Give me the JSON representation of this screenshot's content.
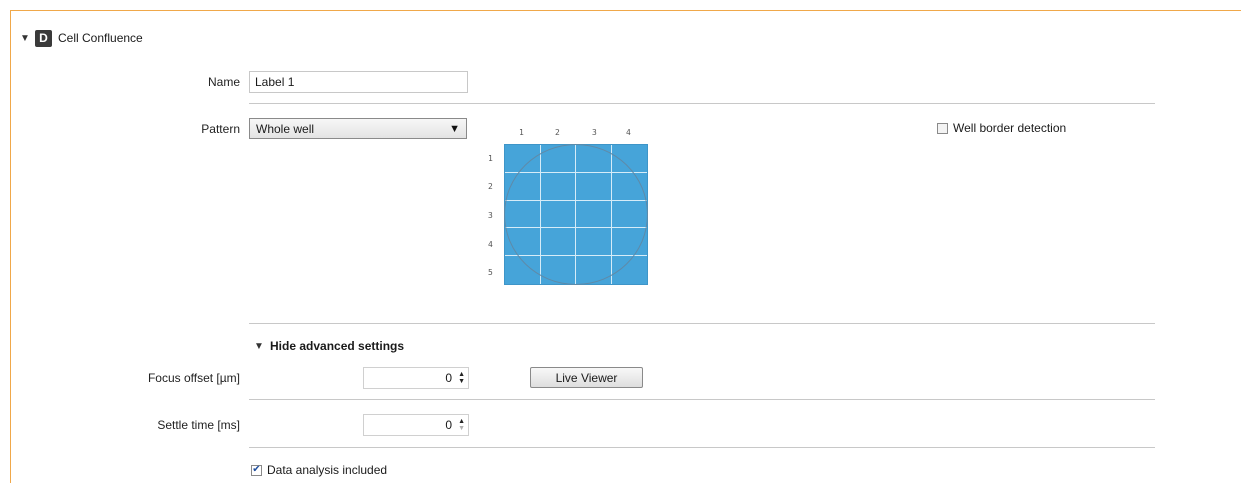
{
  "section": {
    "badge": "D",
    "title": "Cell Confluence",
    "expand_icon": "triangle-down-icon"
  },
  "name_field": {
    "label": "Name",
    "value": "Label 1"
  },
  "pattern": {
    "label": "Pattern",
    "selected": "Whole well",
    "columns": [
      "1",
      "2",
      "3",
      "4"
    ],
    "rows": [
      "1",
      "2",
      "3",
      "4",
      "5"
    ]
  },
  "well_border": {
    "label": "Well border detection",
    "checked": false
  },
  "advanced": {
    "toggle_label": "Hide advanced settings"
  },
  "focus_offset": {
    "label": "Focus offset [µm]",
    "value": "0"
  },
  "live_viewer": {
    "label": "Live Viewer"
  },
  "settle_time": {
    "label": "Settle time [ms]",
    "value": "0"
  },
  "data_analysis": {
    "label": "Data analysis included",
    "checked": true
  },
  "colors": {
    "accent": "#f0a84a",
    "grid_fill": "#46a4d9"
  }
}
